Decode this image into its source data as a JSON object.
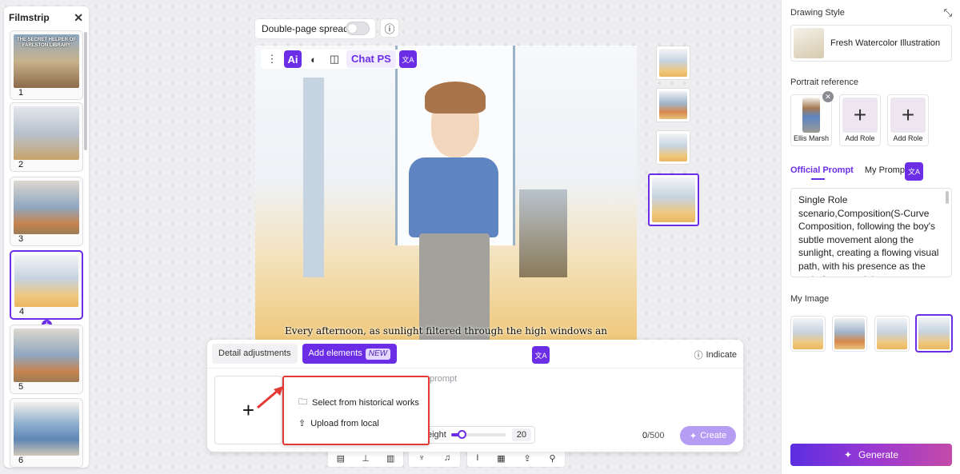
{
  "filmstrip": {
    "title": "Filmstrip",
    "close_icon": "close-icon",
    "pages": [
      {
        "num": "1",
        "cover_text": "THE SECRET HELPER OF FARLSTON LIBRARY"
      },
      {
        "num": "2"
      },
      {
        "num": "3"
      },
      {
        "num": "4",
        "active": true
      },
      {
        "num": "5"
      },
      {
        "num": "6"
      }
    ],
    "add_label": "+"
  },
  "top": {
    "spread_label": "Double-page spread",
    "spread_on": false,
    "info_icon": "info-icon"
  },
  "image_toolbar": {
    "menu_icon": "⋮",
    "ai_label": "Ai",
    "palette_icon": "palette-icon",
    "split_icon": "split-view-icon",
    "chat_label": "Chat PS",
    "translate_icon": "translate-icon"
  },
  "caption": "Every afternoon, as sunlight filtered through the high windows an",
  "panel": {
    "tab_detail": "Detail adjustments",
    "tab_add": "Add elements",
    "badge_new": "NEW",
    "indicate_label": "Indicate",
    "prompt_placeholder": "prompt",
    "weight_label": "eight",
    "weight_value": "20",
    "weight_fraction": 0.2,
    "counter_current": "0",
    "counter_max": "/500",
    "create_label": "Create"
  },
  "popup": {
    "item1": "Select from historical works",
    "item2": "Upload from local"
  },
  "right_panel": {
    "drawing_style_title": "Drawing Style",
    "style_name": "Fresh Watercolor Illustration",
    "portrait_title": "Portrait reference",
    "roles": [
      "Ellis Marsh",
      "Add Role",
      "Add Role"
    ],
    "prompt_tabs": [
      "Official Prompt",
      "My Prompt"
    ],
    "prompt_text": "Single Role scenario,Composition(S-Curve Composition, following the boy's subtle movement along the sunlight, creating a flowing visual path, with his presence as the main focus, and the",
    "my_image_title": "My Image",
    "generate_label": "Generate"
  },
  "colors": {
    "accent": "#6b2ee6",
    "highlight": "#e53935"
  }
}
